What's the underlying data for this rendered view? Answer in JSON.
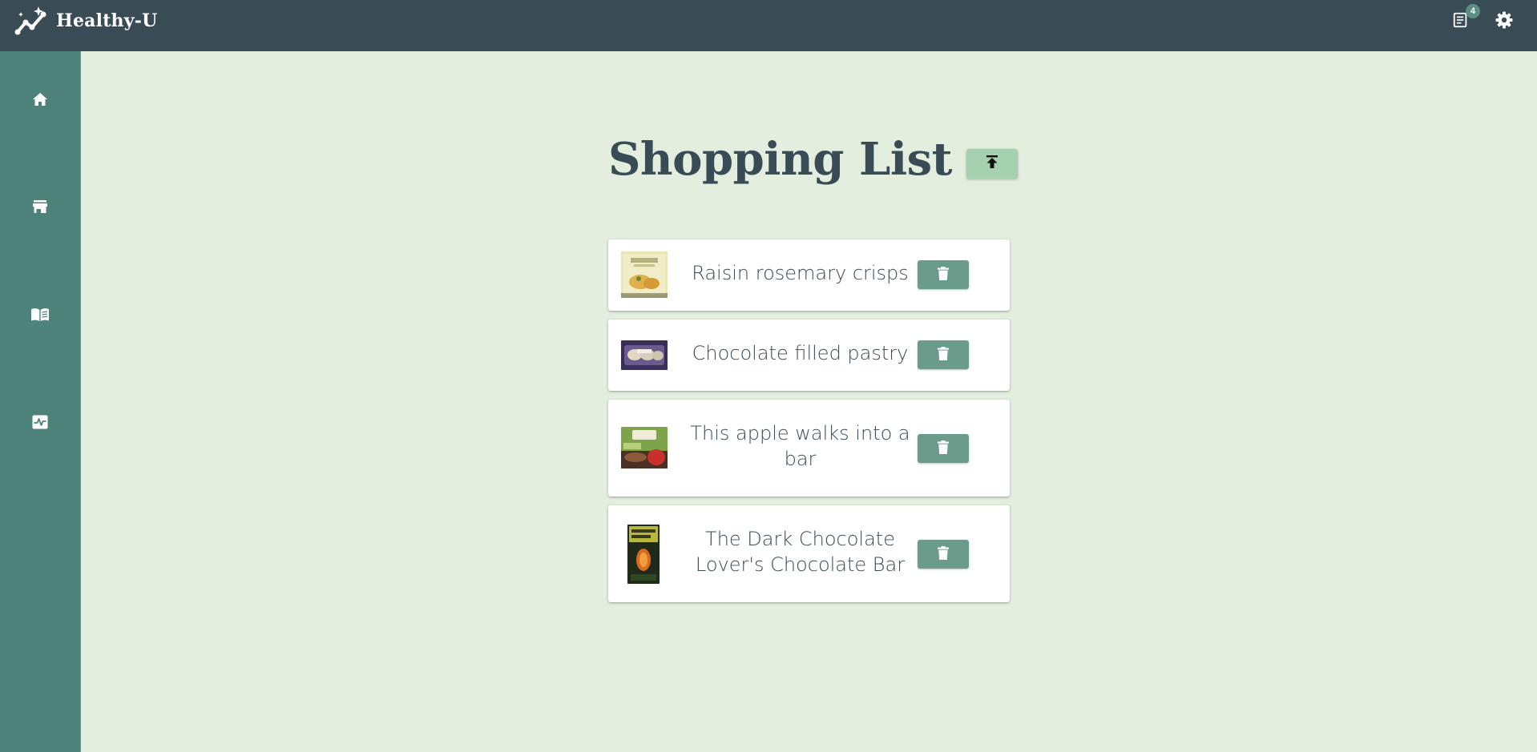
{
  "app": {
    "name": "Healthy-U",
    "logo_icon": "sparkle-trend-icon"
  },
  "header": {
    "list_icon": "list-icon",
    "list_count": "4",
    "settings_icon": "gear-icon"
  },
  "sidebar": {
    "items": [
      {
        "name": "home",
        "icon": "home-icon"
      },
      {
        "name": "store",
        "icon": "store-icon"
      },
      {
        "name": "recipes",
        "icon": "book-icon"
      },
      {
        "name": "health",
        "icon": "activity-icon"
      }
    ]
  },
  "page": {
    "title": "Shopping List",
    "upload_icon": "upload-icon"
  },
  "shopping_list": [
    {
      "name": "Raisin rosemary crisps",
      "delete_icon": "trash-icon"
    },
    {
      "name": "Chocolate filled pastry",
      "delete_icon": "trash-icon"
    },
    {
      "name": "This apple walks into a bar",
      "delete_icon": "trash-icon"
    },
    {
      "name": "The Dark Chocolate Lover's Chocolate Bar",
      "delete_icon": "trash-icon"
    }
  ],
  "colors": {
    "header_bg": "#394b55",
    "sidebar_bg": "#4c827a",
    "page_bg": "#e3eedf",
    "upload_button": "#a6d1b0",
    "delete_button": "#6b9c8b",
    "title_text": "#394b55"
  }
}
